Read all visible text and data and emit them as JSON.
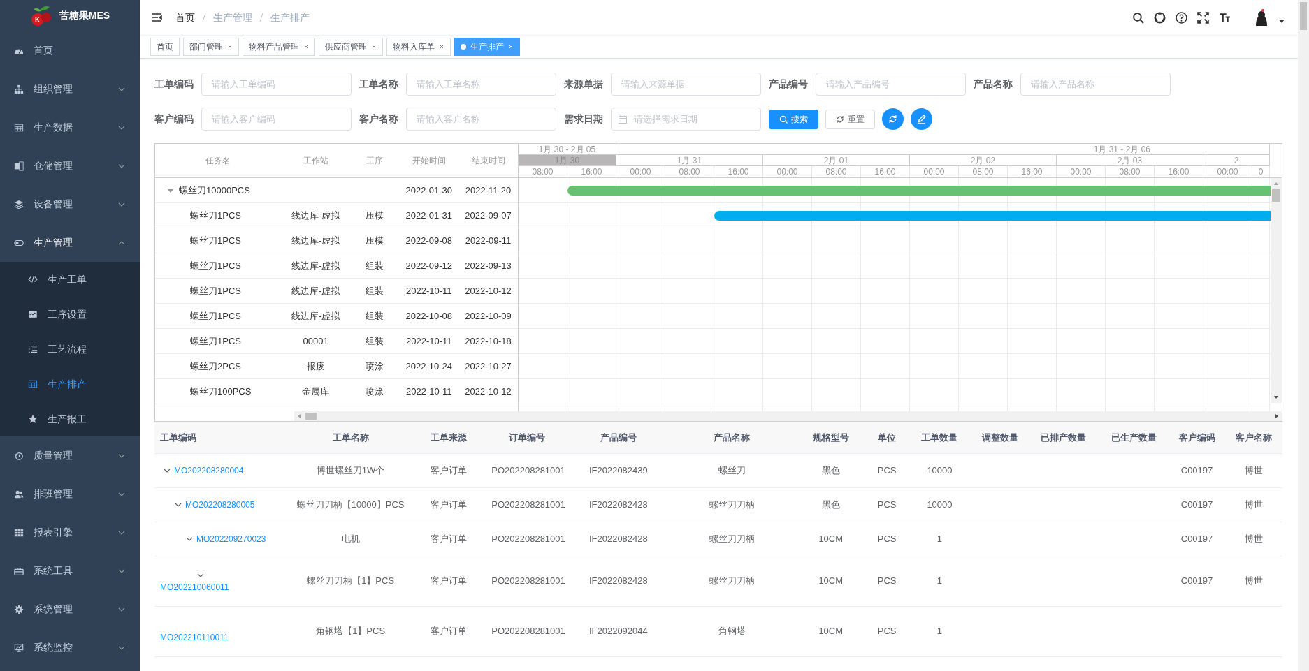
{
  "app": {
    "title": "苦糖果MES",
    "logo_letter": "K"
  },
  "sidebar": {
    "items": [
      {
        "label": "首页",
        "selected": false
      },
      {
        "label": "组织管理",
        "selected": false,
        "expanded": false
      },
      {
        "label": "生产数据",
        "selected": false,
        "expanded": false
      },
      {
        "label": "仓储管理",
        "selected": false,
        "expanded": false
      },
      {
        "label": "设备管理",
        "selected": false,
        "expanded": false
      },
      {
        "label": "生产管理",
        "selected": false,
        "expanded": true,
        "children": [
          {
            "label": "生产工单",
            "selected": false
          },
          {
            "label": "工序设置",
            "selected": false
          },
          {
            "label": "工艺流程",
            "selected": false
          },
          {
            "label": "生产排产",
            "selected": true
          },
          {
            "label": "生产报工",
            "selected": false
          }
        ]
      },
      {
        "label": "质量管理",
        "selected": false,
        "expanded": false
      },
      {
        "label": "排班管理",
        "selected": false,
        "expanded": false
      },
      {
        "label": "报表引擎",
        "selected": false,
        "expanded": false
      },
      {
        "label": "系统工具",
        "selected": false,
        "expanded": false
      },
      {
        "label": "系统管理",
        "selected": false,
        "expanded": false
      },
      {
        "label": "系统监控",
        "selected": false,
        "expanded": false
      }
    ]
  },
  "breadcrumb": [
    "首页",
    "生产管理",
    "生产排产"
  ],
  "tabs": [
    {
      "label": "首页",
      "selected": false,
      "closable": false
    },
    {
      "label": "部门管理",
      "selected": false,
      "closable": true
    },
    {
      "label": "物料产品管理",
      "selected": false,
      "closable": true
    },
    {
      "label": "供应商管理",
      "selected": false,
      "closable": true
    },
    {
      "label": "物料入库单",
      "selected": false,
      "closable": true
    },
    {
      "label": "生产排产",
      "selected": true,
      "closable": true
    }
  ],
  "filters": {
    "fields": [
      {
        "label": "工单编码",
        "placeholder": "请输入工单编码",
        "kind": "text"
      },
      {
        "label": "工单名称",
        "placeholder": "请输入工单名称",
        "kind": "text"
      },
      {
        "label": "来源单据",
        "placeholder": "请输入来源单据",
        "kind": "text"
      },
      {
        "label": "产品编号",
        "placeholder": "请输入产品编号",
        "kind": "text"
      },
      {
        "label": "产品名称",
        "placeholder": "请输入产品名称",
        "kind": "text"
      },
      {
        "label": "客户编码",
        "placeholder": "请输入客户编码",
        "kind": "text"
      },
      {
        "label": "客户名称",
        "placeholder": "请输入客户名称",
        "kind": "text"
      },
      {
        "label": "需求日期",
        "placeholder": "请选择需求日期",
        "kind": "date"
      }
    ],
    "buttons": [
      {
        "label": "搜索",
        "kind": "primary"
      },
      {
        "label": "重置",
        "kind": "default"
      }
    ]
  },
  "gantt": {
    "columns": [
      "任务名",
      "工作站",
      "工序",
      "开始时间",
      "结束时间"
    ],
    "weeks": [
      {
        "label": "1月 30 - 2月 05",
        "days": [
          {
            "label": "1月 30",
            "selected": true,
            "hours": [
              "08:00",
              "16:00"
            ]
          }
        ]
      },
      {
        "label": "1月 31 - 2月 06",
        "days": [
          {
            "label": "1月 31",
            "selected": false,
            "hours": [
              "00:00",
              "08:00",
              "16:00"
            ]
          },
          {
            "label": "2月 01",
            "selected": false,
            "hours": [
              "00:00",
              "08:00",
              "16:00"
            ]
          },
          {
            "label": "2月 02",
            "selected": false,
            "hours": [
              "00:00",
              "08:00",
              "16:00"
            ]
          },
          {
            "label": "2月 03",
            "selected": false,
            "hours": [
              "00:00",
              "08:00",
              "16:00"
            ]
          },
          {
            "label": "2",
            "selected": false,
            "hours": [
              "00:00",
              "0"
            ]
          }
        ]
      }
    ],
    "tasks": [
      {
        "name": "螺丝刀10000PCS",
        "start": "2022-01-30",
        "end": "2022-11-20",
        "expanded": true,
        "bar": {
          "color": "#66c26e"
        },
        "children": [
          {
            "name": "螺丝刀1PCS",
            "station": "线边库-虚拟",
            "process": "压模",
            "start": "2022-01-31",
            "end": "2022-09-07",
            "bar": {
              "color": "#00adef"
            }
          },
          {
            "name": "螺丝刀1PCS",
            "station": "线边库-虚拟",
            "process": "压模",
            "start": "2022-09-08",
            "end": "2022-09-11"
          },
          {
            "name": "螺丝刀1PCS",
            "station": "线边库-虚拟",
            "process": "组装",
            "start": "2022-09-12",
            "end": "2022-09-13"
          },
          {
            "name": "螺丝刀1PCS",
            "station": "线边库-虚拟",
            "process": "组装",
            "start": "2022-10-11",
            "end": "2022-10-12"
          },
          {
            "name": "螺丝刀1PCS",
            "station": "线边库-虚拟",
            "process": "组装",
            "start": "2022-10-08",
            "end": "2022-10-09"
          },
          {
            "name": "螺丝刀1PCS",
            "station": "00001",
            "process": "组装",
            "start": "2022-10-11",
            "end": "2022-10-18"
          },
          {
            "name": "螺丝刀2PCS",
            "station": "报废",
            "process": "喷涂",
            "start": "2022-10-24",
            "end": "2022-10-27"
          },
          {
            "name": "螺丝刀100PCS",
            "station": "金属库",
            "process": "喷涂",
            "start": "2022-10-11",
            "end": "2022-10-12"
          }
        ]
      }
    ]
  },
  "table": {
    "columns": [
      "工单编码",
      "工单名称",
      "工单来源",
      "订单编号",
      "产品编号",
      "产品名称",
      "规格型号",
      "单位",
      "工单数量",
      "调整数量",
      "已排产数量",
      "已生产数量",
      "客户编码",
      "客户名称"
    ],
    "rows": [
      {
        "code": "MO202208280004",
        "name": "博世螺丝刀1W个",
        "source": "客户订单",
        "order_no": "PO202208281001",
        "product_no": "IF2022082439",
        "product_name": "螺丝刀",
        "spec": "黑色",
        "unit": "PCS",
        "quantity": "10000",
        "customer_code": "C00197",
        "customer_name": "博世",
        "expanded": true,
        "children": [
          {
            "code": "MO202208280005",
            "name": "螺丝刀刀柄【10000】PCS",
            "source": "客户订单",
            "order_no": "PO202208281001",
            "product_no": "IF2022082428",
            "product_name": "螺丝刀刀柄",
            "spec": "黑色",
            "unit": "PCS",
            "quantity": "10000",
            "customer_code": "C00197",
            "customer_name": "博世",
            "expanded": true,
            "children": [
              {
                "code": "MO202209270023",
                "name": "电机",
                "source": "客户订单",
                "order_no": "PO202208281001",
                "product_no": "IF2022082428",
                "product_name": "螺丝刀刀柄",
                "spec": "10CM",
                "unit": "PCS",
                "quantity": "1",
                "customer_code": "C00197",
                "customer_name": "博世",
                "expanded": true,
                "children": [
                  {
                    "code": "MO202210060011",
                    "name": "螺丝刀刀柄【1】PCS",
                    "source": "客户订单",
                    "order_no": "PO202208281001",
                    "product_no": "IF2022082428",
                    "product_name": "螺丝刀刀柄",
                    "spec": "10CM",
                    "unit": "PCS",
                    "quantity": "1",
                    "customer_code": "C00197",
                    "customer_name": "博世",
                    "expanded": true,
                    "children": [
                      {
                        "code": "MO202210110011",
                        "name": "角钢塔【1】PCS",
                        "source": "客户订单",
                        "order_no": "PO202208281001",
                        "product_no": "IF2022092044",
                        "product_name": "角钢塔",
                        "spec": "10CM",
                        "unit": "PCS",
                        "quantity": "1"
                      }
                    ]
                  }
                ]
              }
            ]
          }
        ]
      }
    ]
  }
}
